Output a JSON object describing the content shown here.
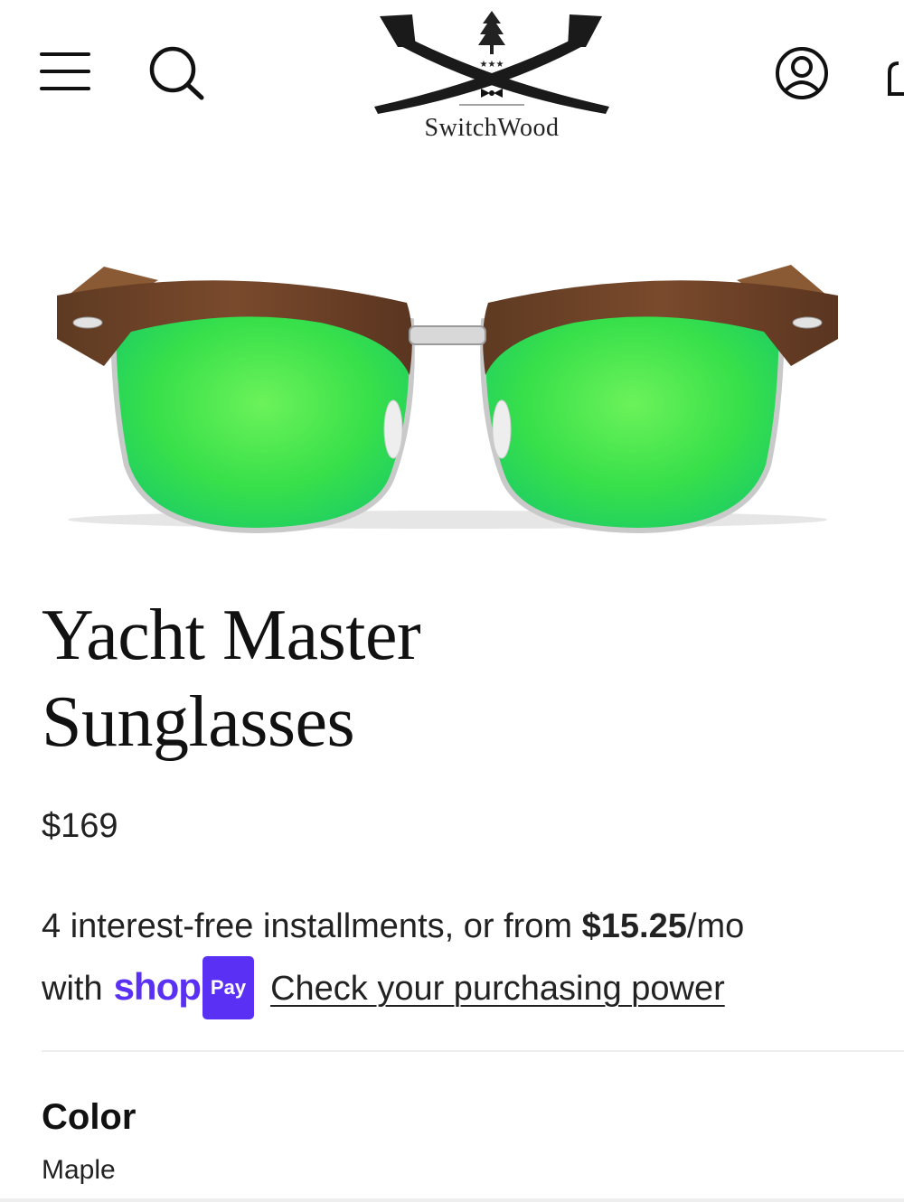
{
  "header": {
    "brand": "SwitchWood",
    "menu_icon": "hamburger-menu-icon",
    "search_icon": "search-icon",
    "account_icon": "account-icon",
    "cart_icon": "cart-icon"
  },
  "product": {
    "image_icon": "sunglasses-product-image",
    "title": "Yacht Master Sunglasses",
    "price": "$169",
    "installments": {
      "text_prefix": "4 interest-free installments, or from ",
      "amount": "$15.25",
      "per": "/mo",
      "with": "with",
      "shop_word": "shop",
      "pay_badge": "Pay",
      "link": "Check your purchasing power"
    },
    "option": {
      "label": "Color",
      "value": "Maple"
    }
  },
  "colors": {
    "shop_pay_purple": "#5a31f4",
    "lens_green": "#3fe24a",
    "frame_wood": "#6b4227"
  }
}
